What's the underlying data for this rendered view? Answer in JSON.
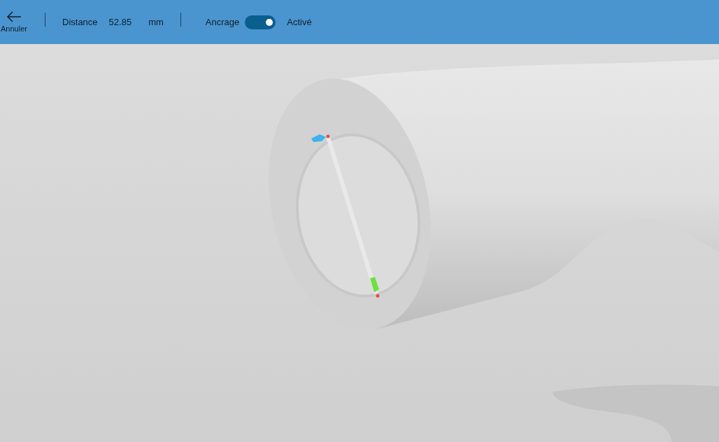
{
  "toolbar": {
    "back_label": "Annuler",
    "distance_label": "Distance",
    "distance_value": "52.85",
    "unit": "mm",
    "anchor_label": "Ancrage",
    "anchor_on": true,
    "anchor_state": "Activé"
  }
}
